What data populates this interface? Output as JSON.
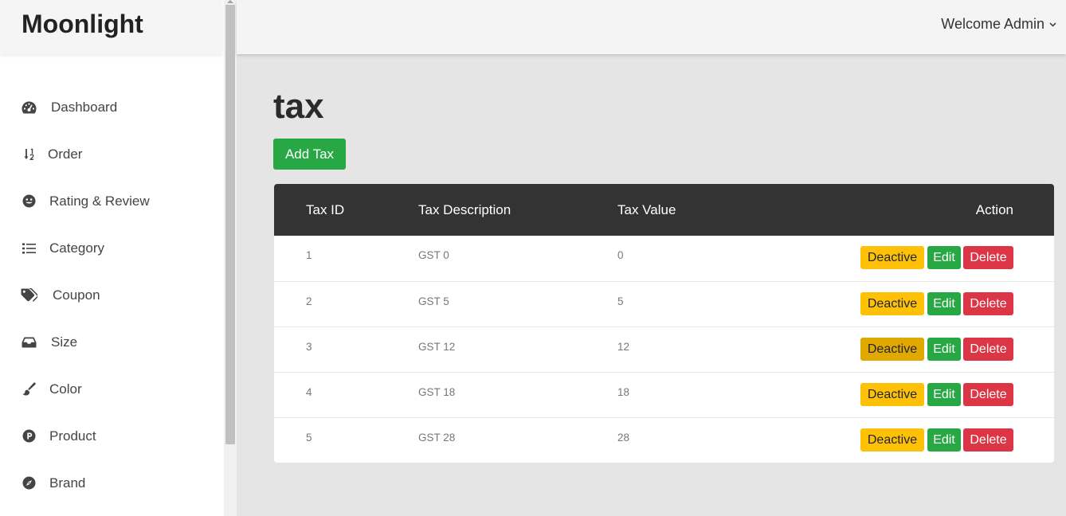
{
  "brand": {
    "logo": "Moonlight"
  },
  "header": {
    "welcome": "Welcome Admin",
    "dropdown_icon": "chevron-down-icon"
  },
  "sidebar": {
    "items": [
      {
        "label": "Dashboard",
        "icon": "tachometer-icon"
      },
      {
        "label": "Order",
        "icon": "sort-numeric-down-icon"
      },
      {
        "label": "Rating & Review",
        "icon": "smile-icon"
      },
      {
        "label": "Category",
        "icon": "list-icon"
      },
      {
        "label": "Coupon",
        "icon": "tags-icon"
      },
      {
        "label": "Size",
        "icon": "inbox-icon"
      },
      {
        "label": "Color",
        "icon": "paint-brush-icon"
      },
      {
        "label": "Product",
        "icon": "product-hunt-icon"
      },
      {
        "label": "Brand",
        "icon": "compass-icon"
      }
    ]
  },
  "page": {
    "title": "tax",
    "add_button": "Add Tax"
  },
  "table": {
    "columns": [
      "Tax ID",
      "Tax Description",
      "Tax Value",
      "Action"
    ],
    "rows": [
      {
        "id": "1",
        "description": "GST 0",
        "value": "0"
      },
      {
        "id": "2",
        "description": "GST 5",
        "value": "5"
      },
      {
        "id": "3",
        "description": "GST 12",
        "value": "12"
      },
      {
        "id": "4",
        "description": "GST 18",
        "value": "18"
      },
      {
        "id": "5",
        "description": "GST 28",
        "value": "28"
      }
    ],
    "actions": {
      "deactive": "Deactive",
      "edit": "Edit",
      "delete": "Delete"
    }
  },
  "colors": {
    "sidebar_bg": "#ffffff",
    "topbar_bg": "#f4f4f4",
    "content_bg": "#e5e5e5",
    "table_header_bg": "#333333",
    "success": "#28a745",
    "warning": "#ffc107",
    "warning_hover": "#e0a800",
    "danger": "#dc3545"
  }
}
